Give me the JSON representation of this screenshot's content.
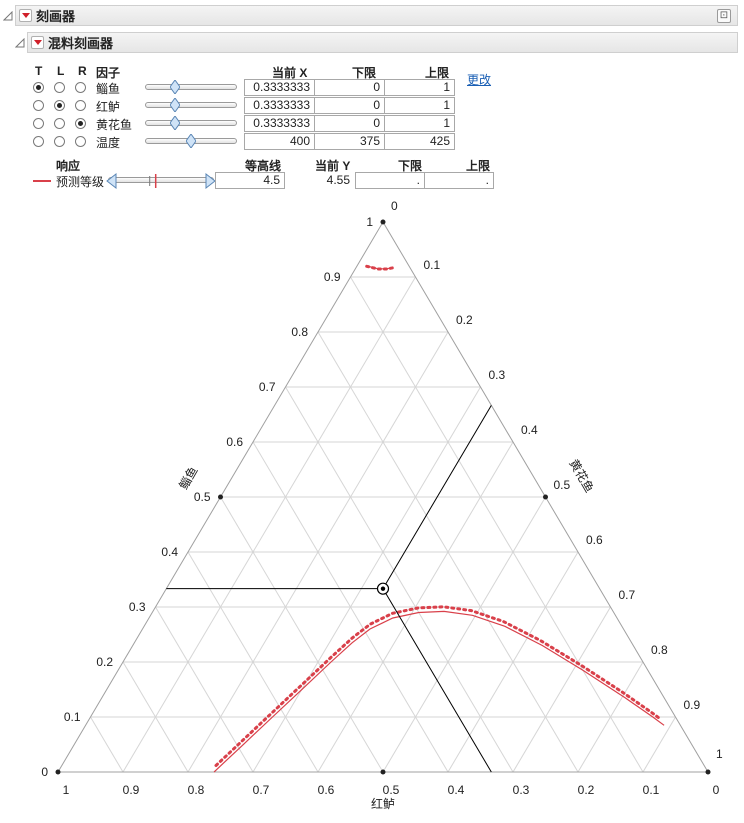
{
  "outer_outline": {
    "title": "刻画器"
  },
  "inner_outline": {
    "title": "混料刻画器"
  },
  "factor_table": {
    "headers": {
      "t": "T",
      "l": "L",
      "r": "R",
      "factor": "因子",
      "current_x": "当前 X",
      "lower": "下限",
      "upper": "上限"
    },
    "update_link": "更改",
    "rows": [
      {
        "name": "鲻鱼",
        "t": true,
        "l": false,
        "r": false,
        "slider": 0.33,
        "current": "0.3333333",
        "lower": "0",
        "upper": "1"
      },
      {
        "name": "红鲈",
        "t": false,
        "l": true,
        "r": false,
        "slider": 0.33,
        "current": "0.3333333",
        "lower": "0",
        "upper": "1"
      },
      {
        "name": "黄花鱼",
        "t": false,
        "l": false,
        "r": true,
        "slider": 0.33,
        "current": "0.3333333",
        "lower": "0",
        "upper": "1"
      },
      {
        "name": "温度",
        "t": false,
        "l": false,
        "r": false,
        "slider": 0.5,
        "current": "400",
        "lower": "375",
        "upper": "425"
      }
    ]
  },
  "response_table": {
    "headers": {
      "response": "响应",
      "contour": "等高线",
      "current_y": "当前 Y",
      "lower": "下限",
      "upper": "上限"
    },
    "rows": [
      {
        "name": "预测等级",
        "line_color": "#d9404a",
        "contour_slider": 0.45,
        "contour": "4.5",
        "current_y": "4.55",
        "lower": ".",
        "upper": "."
      }
    ]
  },
  "chart_data": {
    "type": "ternary",
    "top_axis_title": "鲻鱼",
    "bottom_axis_title": "红鲈",
    "right_axis_title": "黄花鱼",
    "left_tick_labels": [
      "0",
      "0.1",
      "0.2",
      "0.3",
      "0.4",
      "0.5",
      "0.6",
      "0.7",
      "0.8",
      "0.9",
      "1"
    ],
    "bottom_tick_labels": [
      "1",
      "0.9",
      "0.8",
      "0.7",
      "0.6",
      "0.5",
      "0.4",
      "0.3",
      "0.2",
      "0.1",
      "0"
    ],
    "right_tick_labels": [
      "0",
      "0.1",
      "0.2",
      "0.3",
      "0.4",
      "0.5",
      "0.6",
      "0.7",
      "0.8",
      "0.9",
      "1"
    ],
    "grid": true,
    "grid_step": 0.1,
    "current_point": {
      "a": 0.3333333,
      "b": 0.3333333,
      "c": 0.3333333
    },
    "vertex_markers": [
      {
        "a": 1,
        "b": 0,
        "c": 0
      },
      {
        "a": 0,
        "b": 1,
        "c": 0
      },
      {
        "a": 0,
        "b": 0,
        "c": 1
      },
      {
        "a": 0.5,
        "b": 0.5,
        "c": 0
      },
      {
        "a": 0.5,
        "b": 0,
        "c": 0.5
      },
      {
        "a": 0,
        "b": 0.5,
        "c": 0.5
      }
    ],
    "contour_color": "#d9404a",
    "contour_level": 4.5,
    "contour_top": [
      {
        "a": 0.92,
        "b": 0.065,
        "c": 0.015
      },
      {
        "a": 0.915,
        "b": 0.05,
        "c": 0.035
      },
      {
        "a": 0.915,
        "b": 0.037,
        "c": 0.048
      },
      {
        "a": 0.917,
        "b": 0.027,
        "c": 0.056
      }
    ],
    "contour_main": [
      {
        "a": 0,
        "b": 0.76,
        "c": 0.24
      },
      {
        "a": 0.05,
        "b": 0.69,
        "c": 0.26
      },
      {
        "a": 0.1,
        "b": 0.62,
        "c": 0.28
      },
      {
        "a": 0.15,
        "b": 0.55,
        "c": 0.3
      },
      {
        "a": 0.2,
        "b": 0.48,
        "c": 0.32
      },
      {
        "a": 0.235,
        "b": 0.43,
        "c": 0.335
      },
      {
        "a": 0.26,
        "b": 0.39,
        "c": 0.35
      },
      {
        "a": 0.28,
        "b": 0.345,
        "c": 0.375
      },
      {
        "a": 0.29,
        "b": 0.3,
        "c": 0.41
      },
      {
        "a": 0.292,
        "b": 0.26,
        "c": 0.448
      },
      {
        "a": 0.285,
        "b": 0.22,
        "c": 0.495
      },
      {
        "a": 0.265,
        "b": 0.18,
        "c": 0.555
      },
      {
        "a": 0.23,
        "b": 0.14,
        "c": 0.63
      },
      {
        "a": 0.185,
        "b": 0.1,
        "c": 0.715
      },
      {
        "a": 0.135,
        "b": 0.06,
        "c": 0.805
      },
      {
        "a": 0.1,
        "b": 0.035,
        "c": 0.865
      },
      {
        "a": 0.085,
        "b": 0.025,
        "c": 0.89
      }
    ],
    "contour_main_offset_a": 0.012
  }
}
